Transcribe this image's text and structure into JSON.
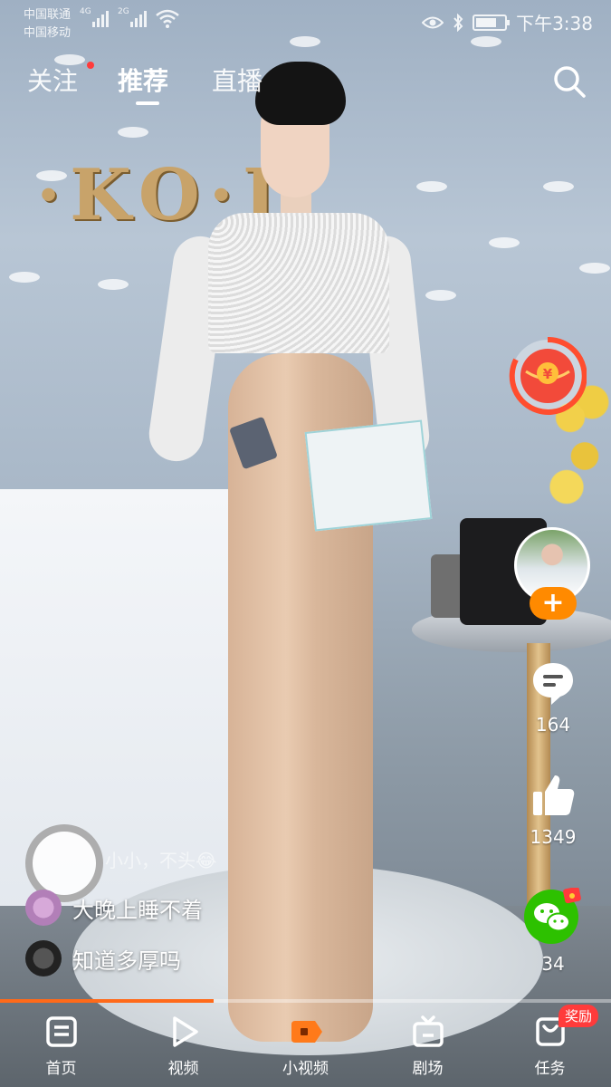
{
  "status_bar": {
    "carrier1": "中国联通",
    "carrier1_net": "4G",
    "carrier2": "中国移动",
    "carrier2_net": "2G",
    "time": "下午3:38"
  },
  "top_nav": {
    "tabs": [
      {
        "label": "关注",
        "has_dot": true
      },
      {
        "label": "推荐",
        "active": true
      },
      {
        "label": "直播"
      }
    ]
  },
  "actions": {
    "comment_count": "164",
    "like_count": "1349",
    "share_count": "34"
  },
  "comments": {
    "scrolling": "小小，不头😂",
    "items": [
      {
        "text": "大晚上睡不着"
      },
      {
        "text": "知道多厚吗"
      }
    ]
  },
  "progress": {
    "fraction": 0.35
  },
  "bottom_nav": {
    "items": [
      {
        "label": "首页",
        "icon": "home-icon"
      },
      {
        "label": "视频",
        "icon": "play-icon"
      },
      {
        "label": "小视频",
        "icon": "short-video-icon",
        "active": true
      },
      {
        "label": "剧场",
        "icon": "tv-icon"
      },
      {
        "label": "任务",
        "icon": "task-icon",
        "badge": "奖励"
      }
    ]
  },
  "colors": {
    "accent": "#ff6a1a",
    "follow_button": "#ff8a00",
    "wechat_green": "#2dc100",
    "badge_red": "#ff3b3b"
  }
}
